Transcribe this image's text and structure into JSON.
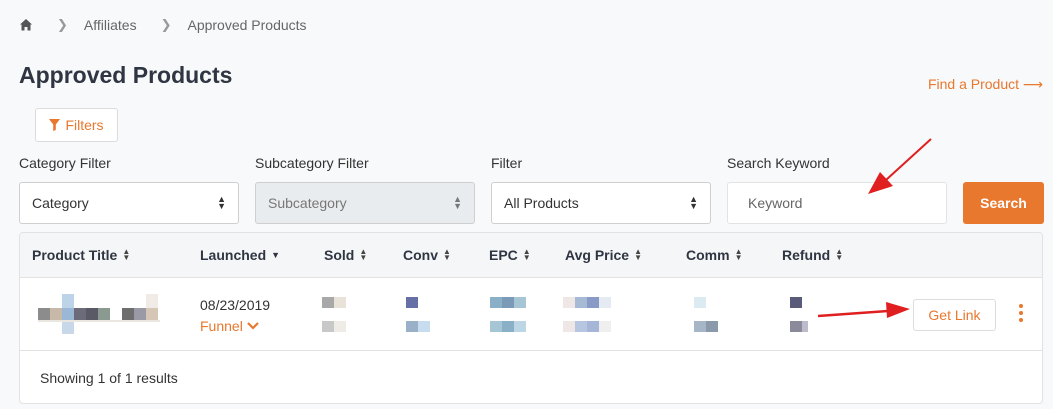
{
  "breadcrumb": {
    "items": [
      "Affiliates",
      "Approved Products"
    ]
  },
  "page": {
    "title": "Approved Products",
    "find_product_label": "Find a Product",
    "filters_label": "Filters"
  },
  "filters": {
    "category_label": "Category Filter",
    "category_value": "Category",
    "subcategory_label": "Subcategory Filter",
    "subcategory_value": "Subcategory",
    "filter_label": "Filter",
    "filter_value": "All Products",
    "keyword_label": "Search Keyword",
    "keyword_placeholder": "Keyword",
    "search_label": "Search"
  },
  "table": {
    "columns": [
      "Product Title",
      "Launched",
      "Sold",
      "Conv",
      "EPC",
      "Avg Price",
      "Comm",
      "Refund"
    ],
    "rows": [
      {
        "launched": "08/23/2019",
        "funnel_label": "Funnel",
        "action_label": "Get Link"
      }
    ],
    "footer": "Showing 1 of 1 results"
  },
  "colors": {
    "accent": "#e8782e",
    "annotation_arrow": "#e02020"
  },
  "icons": {
    "home": "home-icon",
    "chevron": "chevron-right-icon",
    "filter": "funnel-icon",
    "arrow": "arrow-right-icon",
    "kebab": "kebab-menu-icon"
  }
}
